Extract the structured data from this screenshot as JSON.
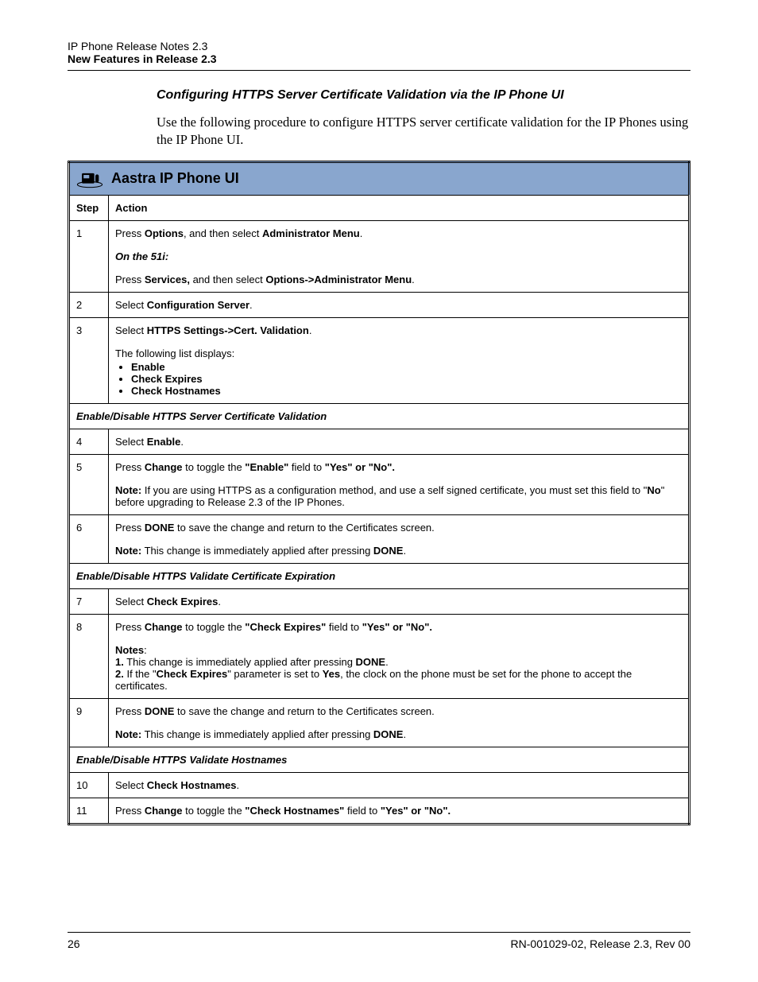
{
  "header": {
    "line1": "IP Phone Release Notes 2.3",
    "line2": "New Features in Release 2.3"
  },
  "section_title": "Configuring HTTPS Server Certificate Validation via the IP Phone UI",
  "intro": "Use the following procedure to configure HTTPS server certificate validation for the IP Phones using the IP Phone UI.",
  "banner": "Aastra IP Phone UI",
  "columns": {
    "step": "Step",
    "action": "Action"
  },
  "rows": {
    "r1": {
      "step": "1",
      "p1a": "Press ",
      "p1b": "Options",
      "p1c": ", and then select ",
      "p1d": "Administrator Menu",
      "p1e": ".",
      "p2": "On the 51i:",
      "p3a": "Press ",
      "p3b": "Services,",
      "p3c": " and then select ",
      "p3d": "Options->Administrator Menu",
      "p3e": "."
    },
    "r2": {
      "step": "2",
      "a": "Select ",
      "b": "Configuration Server",
      "c": "."
    },
    "r3": {
      "step": "3",
      "a": "Select ",
      "b": "HTTPS Settings->Cert. Validation",
      "c": ".",
      "list_intro": "The following list displays:",
      "li1": "Enable",
      "li2": "Check Expires",
      "li3": "Check Hostnames"
    },
    "sub1": "Enable/Disable HTTPS Server Certificate Validation",
    "r4": {
      "step": "4",
      "a": "Select ",
      "b": "Enable",
      "c": "."
    },
    "r5": {
      "step": "5",
      "a": "Press ",
      "b": "Change",
      "c": " to toggle the ",
      "d": "\"Enable\"",
      "e": " field to ",
      "f": "\"Yes\" or \"No\".",
      "n1": "Note:",
      "n2": " If you are using HTTPS as a configuration method, and use a self signed certificate, you must set this field to \"",
      "n3": "No",
      "n4": "\" before upgrading to Release 2.3 of the IP Phones."
    },
    "r6": {
      "step": "6",
      "a": "Press ",
      "b": "DONE",
      "c": " to save the change and return to the Certificates screen.",
      "n1": "Note:",
      "n2": " This change is immediately applied after pressing ",
      "n3": "DONE",
      "n4": "."
    },
    "sub2": "Enable/Disable HTTPS Validate Certificate Expiration",
    "r7": {
      "step": "7",
      "a": "Select ",
      "b": "Check Expires",
      "c": "."
    },
    "r8": {
      "step": "8",
      "a": "Press ",
      "b": "Change",
      "c": " to toggle the ",
      "d": "\"Check Expires\"",
      "e": " field to ",
      "f": "\"Yes\" or \"No\".",
      "nn": "Notes",
      "nnc": ":",
      "l1a": "1.",
      "l1b": " This change is immediately applied after pressing ",
      "l1c": "DONE",
      "l1d": ".",
      "l2a": "2.",
      "l2b": " If the \"",
      "l2c": "Check Expires",
      "l2d": "\" parameter is set to ",
      "l2e": "Yes",
      "l2f": ", the clock on the phone must be set for the phone to accept the certificates."
    },
    "r9": {
      "step": "9",
      "a": "Press ",
      "b": "DONE",
      "c": " to save the change and return to the Certificates screen.",
      "n1": "Note:",
      "n2": " This change is immediately applied after pressing ",
      "n3": "DONE",
      "n4": "."
    },
    "sub3": "Enable/Disable HTTPS Validate Hostnames",
    "r10": {
      "step": "10",
      "a": "Select ",
      "b": "Check Hostnames",
      "c": "."
    },
    "r11": {
      "step": "11",
      "a": "Press ",
      "b": "Change",
      "c": " to toggle the ",
      "d": "\"Check Hostnames\"",
      "e": " field to ",
      "f": "\"Yes\" or \"No\"."
    }
  },
  "footer": {
    "page": "26",
    "doc": "RN-001029-02, Release 2.3, Rev 00"
  }
}
